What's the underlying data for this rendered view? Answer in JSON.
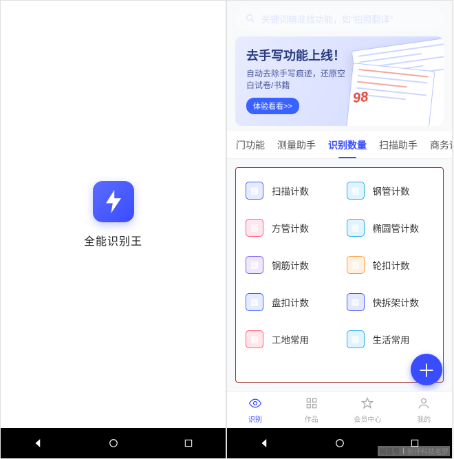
{
  "left": {
    "app_name": "全能识别王"
  },
  "right": {
    "search_placeholder": "关键词精准找功能，如\"拍照翻译\"",
    "banner": {
      "title": "去手写功能上线！",
      "subtitle": "自动去除手写痕迹，还原空白试卷/书籍",
      "button": "体验看看>>",
      "score": "98"
    },
    "tabs": [
      "门功能",
      "测量助手",
      "识别数量",
      "扫描助手",
      "商务识别"
    ],
    "active_tab_index": 2,
    "grid": [
      {
        "label": "扫描计数",
        "icon": "scan-count-icon",
        "cls": "ico-blue"
      },
      {
        "label": "钢管计数",
        "icon": "steel-pipe-icon",
        "cls": "ico-cyan"
      },
      {
        "label": "方管计数",
        "icon": "square-pipe-icon",
        "cls": "ico-pink"
      },
      {
        "label": "椭圆管计数",
        "icon": "oval-pipe-icon",
        "cls": "ico-cyan"
      },
      {
        "label": "钢筋计数",
        "icon": "rebar-icon",
        "cls": "ico-purple"
      },
      {
        "label": "轮扣计数",
        "icon": "wheel-buckle-icon",
        "cls": "ico-orange"
      },
      {
        "label": "盘扣计数",
        "icon": "disc-buckle-icon",
        "cls": "ico-blue"
      },
      {
        "label": "快拆架计数",
        "icon": "quick-frame-icon",
        "cls": "ico-navy"
      },
      {
        "label": "工地常用",
        "icon": "site-common-icon",
        "cls": "ico-pink"
      },
      {
        "label": "生活常用",
        "icon": "life-common-icon",
        "cls": "ico-cyan"
      }
    ],
    "bottom_tabs": [
      {
        "label": "识别",
        "icon": "eye-icon",
        "active": true
      },
      {
        "label": "作品",
        "icon": "grid-icon",
        "active": false
      },
      {
        "label": "会员中心",
        "icon": "star-icon",
        "active": false
      },
      {
        "label": "我的",
        "icon": "user-icon",
        "active": false
      }
    ]
  },
  "watermark": {
    "brand": "网易号",
    "author": "新评科技老罗"
  }
}
